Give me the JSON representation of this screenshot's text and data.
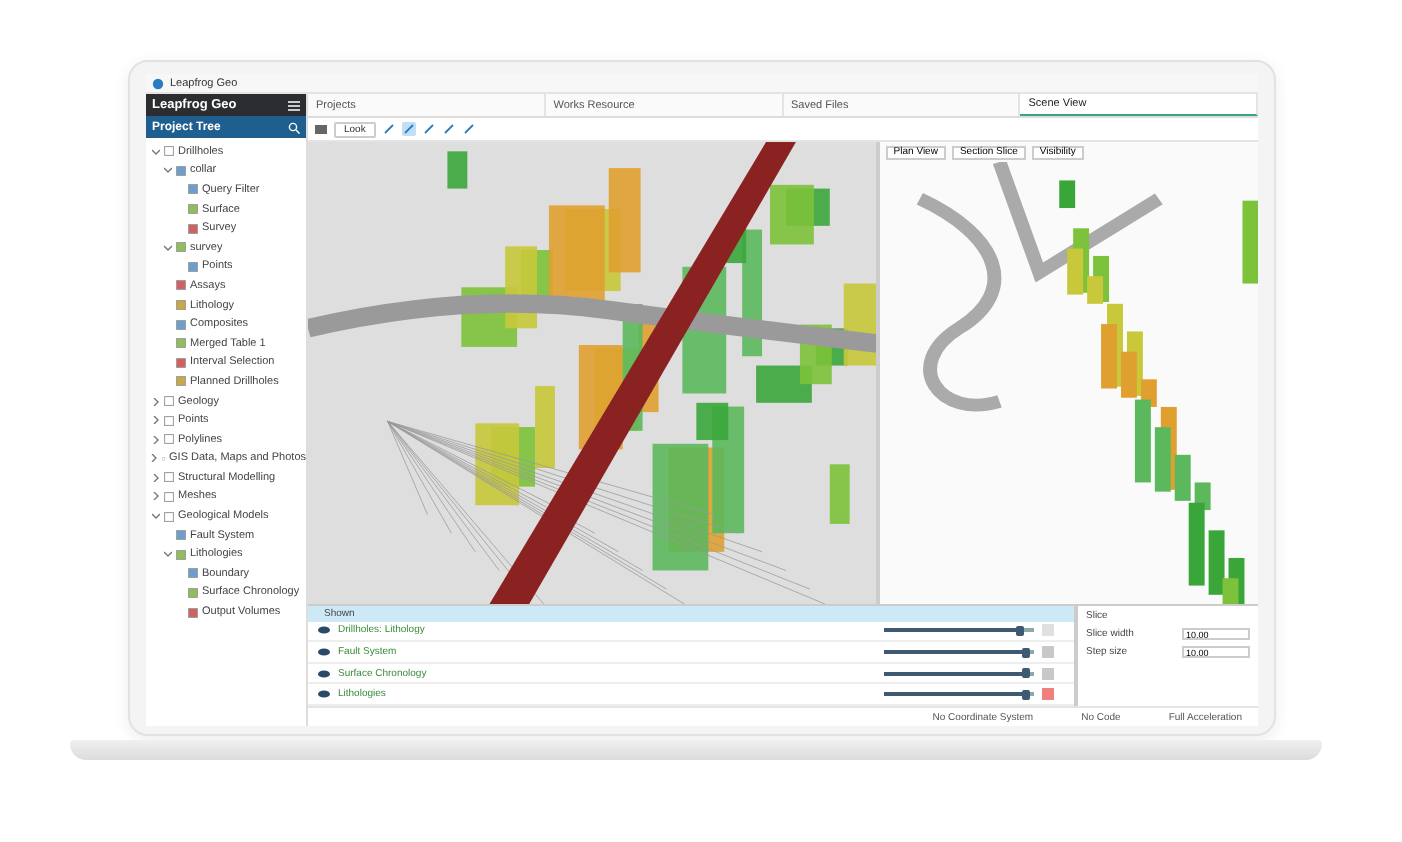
{
  "window": {
    "title": "Leapfrog Geo"
  },
  "sidebar": {
    "app_name": "Leapfrog Geo",
    "panel_title": "Project Tree",
    "tree": [
      {
        "label": "Drillholes",
        "expanded": true,
        "children": [
          {
            "label": "collar",
            "expanded": true,
            "children": [
              {
                "label": "Query Filter"
              },
              {
                "label": "Surface"
              },
              {
                "label": "Survey"
              }
            ]
          },
          {
            "label": "survey",
            "expanded": true,
            "children": [
              {
                "label": "Points"
              }
            ]
          },
          {
            "label": "Assays"
          },
          {
            "label": "Lithology"
          },
          {
            "label": "Composites"
          },
          {
            "label": "Merged Table 1"
          },
          {
            "label": "Interval Selection"
          },
          {
            "label": "Planned Drillholes"
          }
        ]
      },
      {
        "label": "Geology",
        "expanded": false
      },
      {
        "label": "Points",
        "expanded": false
      },
      {
        "label": "Polylines",
        "expanded": false
      },
      {
        "label": "GIS Data, Maps and Photos",
        "expanded": false
      },
      {
        "label": "Structural Modelling",
        "expanded": false
      },
      {
        "label": "Meshes",
        "expanded": false
      },
      {
        "label": "Geological Models",
        "expanded": true,
        "children": [
          {
            "label": "Fault System"
          },
          {
            "label": "Lithologies",
            "expanded": true,
            "children": [
              {
                "label": "Boundary"
              },
              {
                "label": "Surface Chronology"
              },
              {
                "label": "Output Volumes"
              }
            ]
          }
        ]
      }
    ]
  },
  "tabs": [
    {
      "label": "Projects",
      "selected": false
    },
    {
      "label": "Works Resource",
      "selected": false
    },
    {
      "label": "Saved Files",
      "selected": false
    },
    {
      "label": "Scene View",
      "selected": true
    }
  ],
  "toolbar": {
    "view_select": "Look"
  },
  "side_view": {
    "buttons": [
      "Plan View",
      "Section Slice",
      "Visibility"
    ]
  },
  "shown_list": {
    "title": "Shown",
    "rows": [
      {
        "name": "Drillholes: Lithology",
        "visible": true,
        "color": "#e0e0e0",
        "level": 0.9
      },
      {
        "name": "Fault System",
        "visible": true,
        "color": "#c8c8c8",
        "level": 0.95
      },
      {
        "name": "Surface Chronology",
        "visible": true,
        "color": "#c8c8c8",
        "level": 0.95
      },
      {
        "name": "Lithologies",
        "visible": true,
        "color": "#f08080",
        "level": 0.95
      }
    ]
  },
  "properties": {
    "title": "Slice",
    "fields": [
      {
        "label": "Slice width",
        "value": "10.00"
      },
      {
        "label": "Step size",
        "value": "10.00"
      }
    ]
  },
  "status_bar": [
    "No Coordinate System",
    "No Code",
    "Full Acceleration"
  ]
}
